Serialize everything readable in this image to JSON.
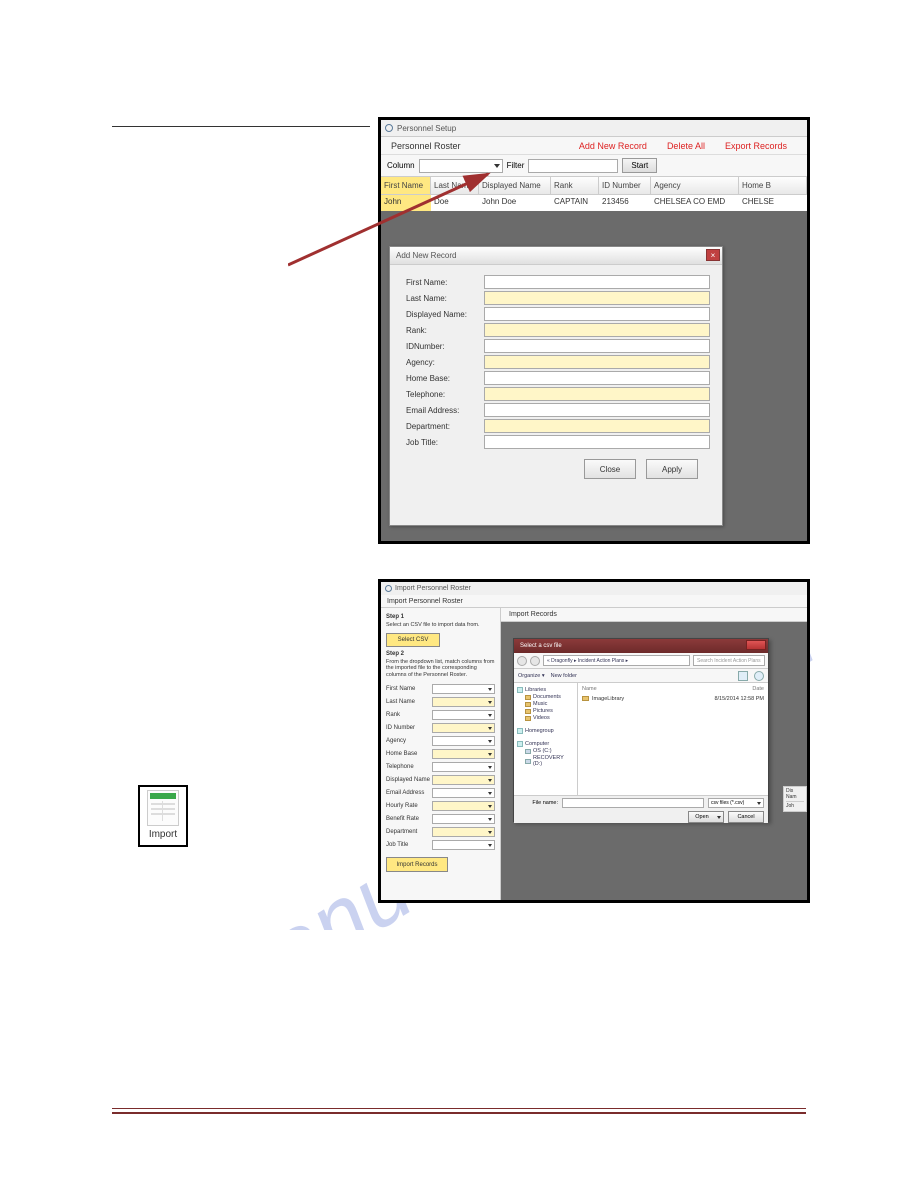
{
  "fig1": {
    "window_title": "Personnel Setup",
    "roster_title": "Personnel Roster",
    "links": {
      "add": "Add New Record",
      "delete": "Delete All",
      "export": "Export Records"
    },
    "filter": {
      "column_label": "Column",
      "filter_label": "Filter",
      "start": "Start"
    },
    "columns": [
      "First Name",
      "Last Name",
      "Displayed Name",
      "Rank",
      "ID Number",
      "Agency",
      "Home B"
    ],
    "row": [
      "John",
      "Doe",
      "John Doe",
      "CAPTAIN",
      "213456",
      "CHELSEA CO EMD",
      "CHELSE"
    ],
    "dialog": {
      "title": "Add New Record",
      "fields": [
        "First Name:",
        "Last Name:",
        "Displayed Name:",
        "Rank:",
        "IDNumber:",
        "Agency:",
        "Home Base:",
        "Telephone:",
        "Email Address:",
        "Department:",
        "Job Title:"
      ],
      "close": "Close",
      "apply": "Apply"
    }
  },
  "fig2": {
    "window_title": "Import Personnel Roster",
    "toolbar_title": "Import Personnel Roster",
    "right_title": "Import Records",
    "left": {
      "step1": "Step 1",
      "step1_text": "Select an CSV file to import data from.",
      "select_csv": "Select CSV",
      "step2": "Step 2",
      "step2_text": "From the dropdown list, match columns from the imported file to the corresponding columns of the Personnel Roster.",
      "fields": [
        "First Name",
        "Last Name",
        "Rank",
        "ID Number",
        "Agency",
        "Home Base",
        "Telephone",
        "Displayed Name",
        "Email Address",
        "Hourly Rate",
        "Benefit Rate",
        "Department",
        "Job Title"
      ],
      "import_btn": "Import Records"
    },
    "right_stub": {
      "l1": "Dis",
      "l2": "Nam",
      "l3": "Joh"
    },
    "file_dialog": {
      "title": "Select a csv file",
      "path": "« Dragonfly ▸ Incident Action Plans ▸",
      "search_placeholder": "Search Incident Action Plans",
      "organize": "Organize ▾",
      "new_folder": "New folder",
      "tree": {
        "libraries": "Libraries",
        "documents": "Documents",
        "music": "Music",
        "pictures": "Pictures",
        "videos": "Videos",
        "homegroup": "Homegroup",
        "computer": "Computer",
        "os": "OS (C:)",
        "recovery": "RECOVERY (D:)"
      },
      "list_headers": {
        "name": "Name",
        "date": "Date"
      },
      "items": [
        {
          "name": "ImageLibrary",
          "date": "8/15/2014 12:58 PM"
        }
      ],
      "file_name_label": "File name:",
      "file_type": "csv files (*.csv)",
      "open": "Open",
      "cancel": "Cancel"
    }
  },
  "import_icon_label": "Import",
  "watermark_text": "manualshive.com"
}
